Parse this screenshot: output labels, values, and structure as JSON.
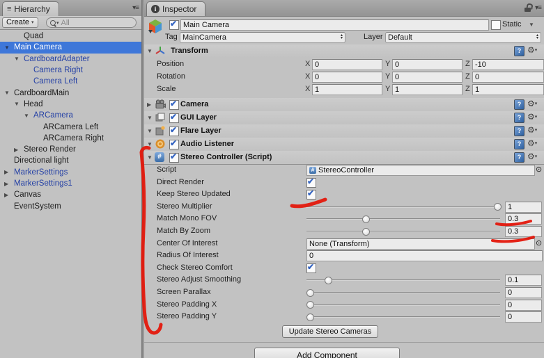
{
  "colors": {
    "selection_blue": "#3e77d9",
    "prefab_text_blue": "#2440a5",
    "annotation_red": "#e41408",
    "panel_bg": "#c2c2c2"
  },
  "hierarchy": {
    "tab": "Hierarchy",
    "create_button": "Create",
    "search_placeholder": "All",
    "items": [
      {
        "label": "Quad",
        "indent": 1,
        "arrow": "none",
        "prefab": false,
        "selected": false
      },
      {
        "label": "Main Camera",
        "indent": 0,
        "arrow": "down",
        "prefab": true,
        "selected": true
      },
      {
        "label": "CardboardAdapter",
        "indent": 1,
        "arrow": "down",
        "prefab": true,
        "selected": false
      },
      {
        "label": "Camera Right",
        "indent": 2,
        "arrow": "none",
        "prefab": true,
        "selected": false
      },
      {
        "label": "Camera Left",
        "indent": 2,
        "arrow": "none",
        "prefab": true,
        "selected": false
      },
      {
        "label": "CardboardMain",
        "indent": 0,
        "arrow": "down",
        "prefab": false,
        "selected": false
      },
      {
        "label": "Head",
        "indent": 1,
        "arrow": "down",
        "prefab": false,
        "selected": false
      },
      {
        "label": "ARCamera",
        "indent": 2,
        "arrow": "down",
        "prefab": true,
        "selected": false
      },
      {
        "label": "ARCamera Left",
        "indent": 3,
        "arrow": "none",
        "prefab": false,
        "selected": false
      },
      {
        "label": "ARCamera Right",
        "indent": 3,
        "arrow": "none",
        "prefab": false,
        "selected": false
      },
      {
        "label": "Stereo Render",
        "indent": 1,
        "arrow": "right",
        "prefab": false,
        "selected": false
      },
      {
        "label": "Directional light",
        "indent": 0,
        "arrow": "none",
        "prefab": false,
        "selected": false
      },
      {
        "label": "MarkerSettings",
        "indent": 0,
        "arrow": "right",
        "prefab": true,
        "selected": false
      },
      {
        "label": "MarkerSettings1",
        "indent": 0,
        "arrow": "right",
        "prefab": true,
        "selected": false
      },
      {
        "label": "Canvas",
        "indent": 0,
        "arrow": "right",
        "prefab": false,
        "selected": false
      },
      {
        "label": "EventSystem",
        "indent": 0,
        "arrow": "none",
        "prefab": false,
        "selected": false
      }
    ]
  },
  "inspector": {
    "tab": "Inspector",
    "header": {
      "name": "Main Camera",
      "active": true,
      "static_label": "Static",
      "static_checked": false,
      "tag_label": "Tag",
      "tag_value": "MainCamera",
      "layer_label": "Layer",
      "layer_value": "Default",
      "icon": "gameobject-cube-icon"
    },
    "axis_labels": [
      "X",
      "Y",
      "Z"
    ],
    "transform": {
      "title": "Transform",
      "icon": "transform-axis-icon",
      "expanded": true,
      "rows": [
        {
          "label": "Position",
          "x": "0",
          "y": "0",
          "z": "-10"
        },
        {
          "label": "Rotation",
          "x": "0",
          "y": "0",
          "z": "0"
        },
        {
          "label": "Scale",
          "x": "1",
          "y": "1",
          "z": "1"
        }
      ]
    },
    "components": [
      {
        "title": "Camera",
        "icon": "camera-icon",
        "arrow": "right",
        "enabled": true
      },
      {
        "title": "GUI Layer",
        "icon": "gui-layer-icon",
        "arrow": "down",
        "enabled": true
      },
      {
        "title": "Flare Layer",
        "icon": "flare-layer-icon",
        "arrow": "down",
        "enabled": true
      },
      {
        "title": "Audio Listener",
        "icon": "audio-listener-icon",
        "arrow": "down",
        "enabled": true
      }
    ],
    "stereo": {
      "title": "Stereo Controller (Script)",
      "icon": "csharp-script-icon",
      "arrow": "down",
      "enabled": true,
      "rows": [
        {
          "label": "Script",
          "type": "object",
          "value": "StereoController",
          "obj_icon": true
        },
        {
          "label": "Direct Render",
          "type": "checkbox",
          "checked": true
        },
        {
          "label": "Keep Stereo Updated",
          "type": "checkbox",
          "checked": true
        },
        {
          "label": "Stereo Multiplier",
          "type": "slider",
          "fraction": 1.0,
          "value": "1"
        },
        {
          "label": "Match Mono FOV",
          "type": "slider",
          "fraction": 0.3,
          "value": "0.3"
        },
        {
          "label": "Match By Zoom",
          "type": "slider",
          "fraction": 0.3,
          "value": "0.3"
        },
        {
          "label": "Center Of Interest",
          "type": "object",
          "value": "None (Transform)",
          "obj_icon": false
        },
        {
          "label": "Radius Of Interest",
          "type": "text",
          "value": "0"
        },
        {
          "label": "Check Stereo Comfort",
          "type": "checkbox",
          "checked": true
        },
        {
          "label": "Stereo Adjust Smoothing",
          "type": "slider",
          "fraction": 0.1,
          "value": "0.1"
        },
        {
          "label": "Screen Parallax",
          "type": "slider",
          "fraction": 0,
          "value": "0"
        },
        {
          "label": "Stereo Padding X",
          "type": "slider",
          "fraction": 0,
          "value": "0"
        },
        {
          "label": "Stereo Padding Y",
          "type": "slider",
          "fraction": 0,
          "value": "0"
        }
      ],
      "update_button": "Update Stereo Cameras"
    },
    "add_component_button": "Add Component"
  }
}
